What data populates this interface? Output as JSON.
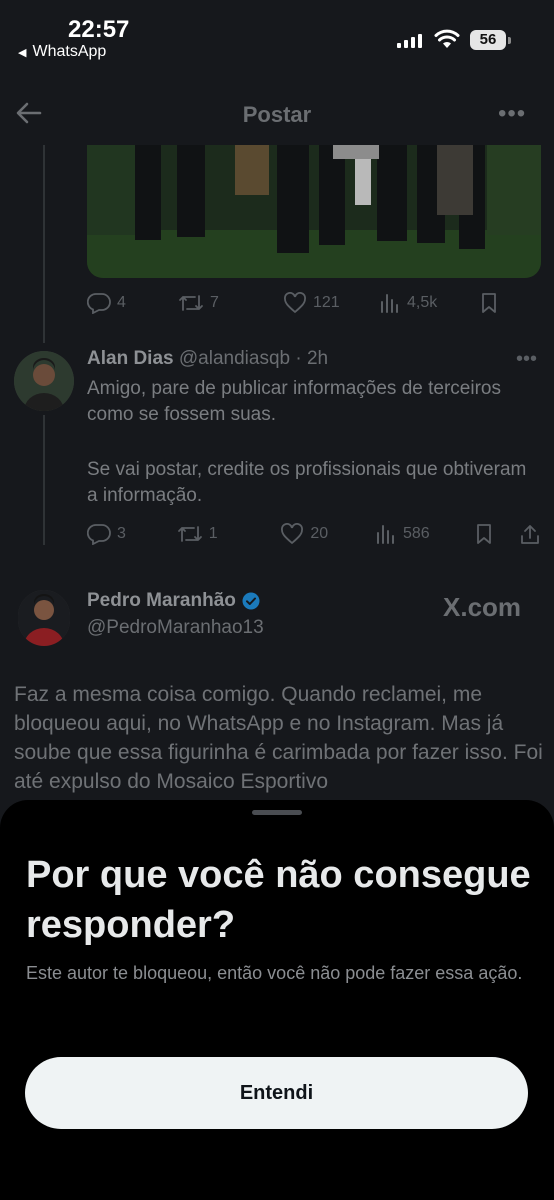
{
  "status": {
    "time": "22:57",
    "back_app": "WhatsApp",
    "battery": "56"
  },
  "header": {
    "title": "Postar"
  },
  "post_actions": {
    "replies": "4",
    "reposts": "7",
    "likes": "121",
    "views": "4,5k"
  },
  "reply": {
    "name": "Alan Dias",
    "handle": "@alandiasqb",
    "time": "· 2h",
    "text1": "Amigo, pare de publicar informações de terceiros como se fossem suas.",
    "text2": "Se vai postar, credite os profissionais que obtiveram a informação.",
    "actions": {
      "replies": "3",
      "reposts": "1",
      "likes": "20",
      "views": "586"
    }
  },
  "quoted": {
    "name": "Pedro Maranhão",
    "handle": "@PedroMaranhao13",
    "source": "X.com",
    "body": "Faz a mesma coisa comigo. Quando reclamei, me bloqueou aqui, no WhatsApp e no Instagram. Mas já soube que essa figurinha é carimbada por fazer isso. Foi até expulso do Mosaico Esportivo"
  },
  "sheet": {
    "title": "Por que você não consegue responder?",
    "subtitle": "Este autor te bloqueou, então você não pode fazer essa ação.",
    "button": "Entendi"
  },
  "colors": {
    "background": "#16181c",
    "sheet": "#000000",
    "button": "#eff3f4",
    "verified": "#1d9bf0"
  },
  "icons": [
    "back-arrow-icon",
    "more-icon",
    "reply-icon",
    "repost-icon",
    "like-icon",
    "views-icon",
    "bookmark-icon",
    "share-icon",
    "verified-icon"
  ]
}
